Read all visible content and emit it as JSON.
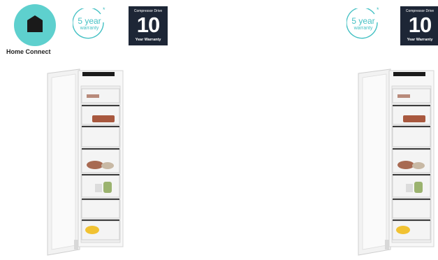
{
  "home_connect": {
    "label": "Home Connect",
    "icon": "home-connect-house-icon",
    "circle_color": "#5ed0ce"
  },
  "warranty": {
    "line1": "5 year",
    "line2": "warranty",
    "star": "*",
    "color": "#45c1c4"
  },
  "compressor": {
    "title": "Compressor Drive",
    "number": "10",
    "subtitle": "Year Warranty",
    "bg_color": "#1d2636"
  },
  "products": [
    {
      "name": "freezer-left",
      "icon": "freezer-open-door-image"
    },
    {
      "name": "freezer-right",
      "icon": "freezer-open-door-image"
    }
  ]
}
